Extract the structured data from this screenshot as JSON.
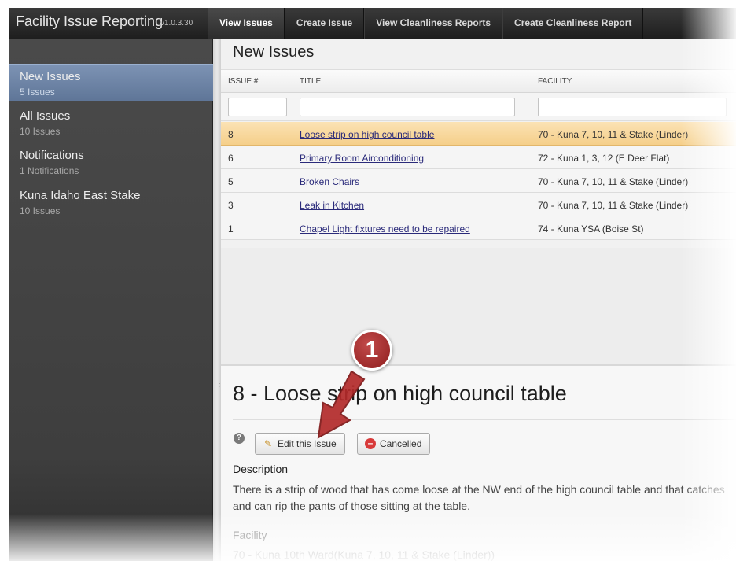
{
  "app": {
    "title": "Facility Issue Reporting",
    "version": "v1.0.3.30"
  },
  "nav": {
    "tabs": [
      {
        "label": "View Issues",
        "active": true
      },
      {
        "label": "Create Issue",
        "active": false
      },
      {
        "label": "View Cleanliness Reports",
        "active": false
      },
      {
        "label": "Create Cleanliness Report",
        "active": false
      }
    ]
  },
  "sidebar": {
    "items": [
      {
        "label": "New Issues",
        "sub": "5 Issues",
        "active": true
      },
      {
        "label": "All Issues",
        "sub": "10 Issues",
        "active": false
      },
      {
        "label": "Notifications",
        "sub": "1 Notifications",
        "active": false
      },
      {
        "label": "Kuna Idaho East Stake",
        "sub": "10 Issues",
        "active": false
      }
    ]
  },
  "main": {
    "title": "New Issues",
    "columns": [
      "ISSUE #",
      "TITLE",
      "FACILITY"
    ],
    "rows": [
      {
        "id": "8",
        "title": "Loose strip on high council table",
        "facility": "70 - Kuna 7, 10, 11 & Stake (Linder)",
        "selected": true
      },
      {
        "id": "6",
        "title": "Primary Room Airconditioning",
        "facility": "72 - Kuna 1, 3, 12 (E Deer Flat)",
        "selected": false
      },
      {
        "id": "5",
        "title": "Broken Chairs",
        "facility": "70 - Kuna 7, 10, 11 & Stake (Linder)",
        "selected": false
      },
      {
        "id": "3",
        "title": "Leak in Kitchen",
        "facility": "70 - Kuna 7, 10, 11 & Stake (Linder)",
        "selected": false
      },
      {
        "id": "1",
        "title": "Chapel Light fixtures need to be repaired",
        "facility": "74 - Kuna YSA (Boise St)",
        "selected": false
      }
    ]
  },
  "detail": {
    "title": "8 - Loose strip on high council table",
    "help_icon": "?",
    "edit_button": "Edit this Issue",
    "cancel_button": "Cancelled",
    "description_label": "Description",
    "description": "There is a strip of wood that has come loose at the NW end of the high council table and that catches and can rip the pants of those sitting at the table.",
    "facility_label": "Facility",
    "facility_value": "70 - Kuna 10th Ward(Kuna 7, 10, 11 & Stake (Linder))"
  },
  "annotation": {
    "number": "1"
  },
  "colors": {
    "selected_row": "#f5cf8a",
    "sidebar_active": "#6c83a6",
    "callout": "#a42a2a",
    "topbar": "#2a2a2a"
  }
}
